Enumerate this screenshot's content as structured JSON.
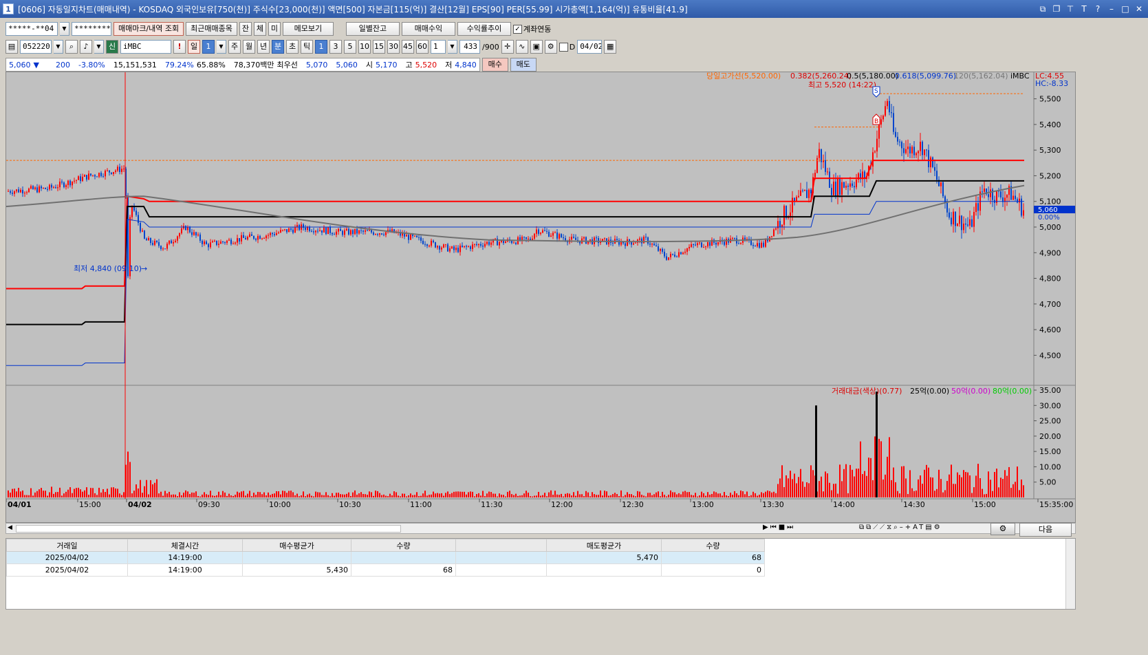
{
  "window": {
    "num": "1",
    "title": "[0606] 자동일지차트(매매내역) - KOSDAQ 외국인보유[750(천)] 주식수[23,000(천)] 액면[500] 자본금[115(억)] 결산[12월] EPS[90] PER[55.99] 시가총액[1,164(억)] 유통비율[41.9]"
  },
  "toolbar1": {
    "account": "*****-**04",
    "password": "********",
    "btn_mark": "매매마크/내역 조회",
    "btn_recent": "최근매매종목",
    "btn_jan": "잔",
    "btn_che": "체",
    "btn_mi": "미",
    "btn_memo": "메모보기",
    "btn_daily": "일별잔고",
    "btn_profit": "매매수익",
    "btn_rate": "수익률추이",
    "chk_link": "계좌연동"
  },
  "toolbar2": {
    "code": "052220",
    "sin": "신",
    "name": "iMBC",
    "periods": [
      "일",
      "1",
      "주",
      "월",
      "년",
      "분",
      "초",
      "틱"
    ],
    "intervals": [
      "1",
      "3",
      "5",
      "10",
      "15",
      "30",
      "45",
      "60"
    ],
    "unit": "1",
    "count": "433",
    "count_max": "/900",
    "d_label": "D",
    "date": "04/02"
  },
  "quote": {
    "price": "5,060",
    "arrow": "▼",
    "change": "200",
    "rate": "-3.80%",
    "volume": "15,151,531",
    "ratio1": "79.24%",
    "ratio2": "65.88%",
    "amount": "78,370백만",
    "best_label": "최우선",
    "ask": "5,070",
    "bid": "5,060",
    "open_label": "시",
    "open": "5,170",
    "high_label": "고",
    "high": "5,520",
    "low_label": "저",
    "low": "4,840",
    "buy_btn": "매수",
    "sell_btn": "매도"
  },
  "price_legend": {
    "l1": "당일고가선(5,520.00)",
    "l2": "0.382(5,260.24)",
    "l3": "0.5(5,180.00)",
    "l4": "0.618(5,099.76)",
    "l5": "120(5,162.04)",
    "l6": "iMBC",
    "lc": "LC:4.55",
    "hc": "HC:-8.33",
    "high_note": "최고 5,520 (14:22)",
    "low_note": "최저 4,840 (09:10)",
    "last_price": "5,060",
    "last_pct": "0.00%"
  },
  "volume_legend": {
    "l1": "거래대금(색상)(0.77)",
    "l2": "25억(0.00)",
    "l3": "50억(0.00)",
    "l4": "80억(0.00)"
  },
  "price_axis": [
    "5,500",
    "5,400",
    "5,300",
    "5,200",
    "5,100",
    "5,000",
    "4,900",
    "4,800",
    "4,700",
    "4,600",
    "4,500"
  ],
  "volume_axis": [
    "35.00",
    "30.00",
    "25.00",
    "20.00",
    "15.00",
    "10.00",
    "5.00"
  ],
  "time_axis": [
    "04/01",
    "15:00",
    "04/02",
    "09:30",
    "10:00",
    "10:30",
    "11:00",
    "11:30",
    "12:00",
    "12:30",
    "13:00",
    "13:30",
    "14:00",
    "14:30",
    "15:00",
    "15:35:00"
  ],
  "next_btn": "다음",
  "table": {
    "headers": [
      "거래일",
      "체결시간",
      "매수평균가",
      "수량",
      "",
      "매도평균가",
      "수량"
    ],
    "rows": [
      [
        "2025/04/02",
        "14:19:00",
        "",
        "",
        "",
        "5,470",
        "68"
      ],
      [
        "2025/04/02",
        "14:19:00",
        "5,430",
        "68",
        "",
        "",
        "0"
      ]
    ]
  },
  "colors": {
    "up": "#ff0000",
    "down": "#0044cc",
    "high_line": "#ff6600",
    "chart_bg": "#c0c0c0"
  }
}
